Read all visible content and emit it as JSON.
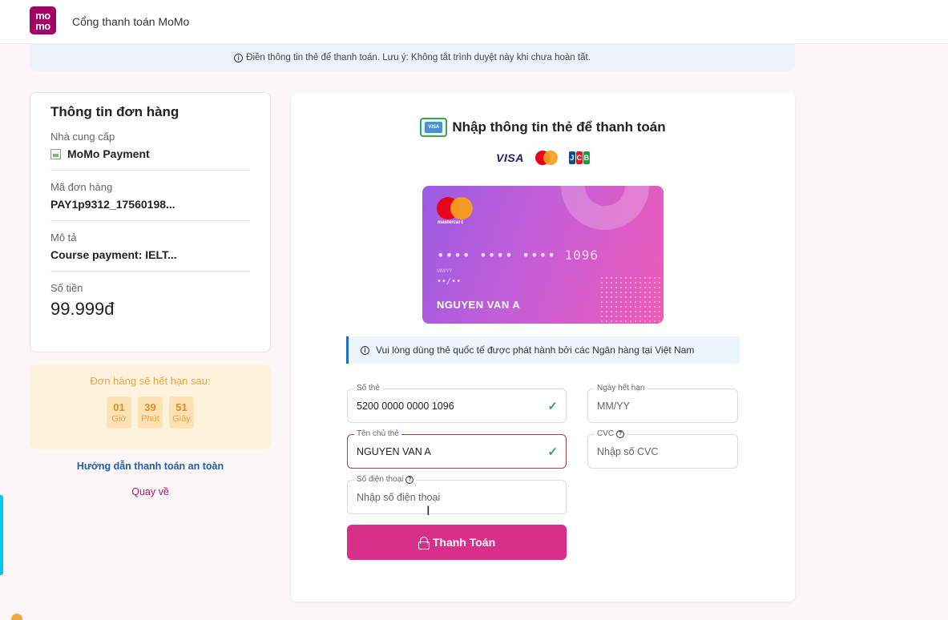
{
  "header": {
    "logo_top": "mo",
    "logo_bottom": "mo",
    "title": "Cổng thanh toán MoMo"
  },
  "notice": {
    "text": "Điền thông tin thẻ để thanh toán. Lưu ý: Không tắt trình duyệt này khi chưa hoàn tất."
  },
  "order": {
    "title": "Thông tin đơn hàng",
    "provider_label": "Nhà cung cấp",
    "provider_value": "MoMo Payment",
    "order_id_label": "Mã đơn hàng",
    "order_id_value": "PAY1p9312_17560198...",
    "desc_label": "Mô tả",
    "desc_value": "Course payment: IELT...",
    "amount_label": "Số tiền",
    "amount_value": "99.999đ"
  },
  "countdown": {
    "title": "Đơn hàng sẽ hết hạn sau:",
    "hours": "01",
    "hours_unit": "Giờ",
    "minutes": "39",
    "minutes_unit": "Phút",
    "seconds": "51",
    "seconds_unit": "Giây"
  },
  "links": {
    "guide": "Hướng dẫn thanh toán an toàn",
    "back": "Quay về"
  },
  "payment": {
    "title": "Nhập thông tin thẻ để thanh toán",
    "card_icon_text": "VISA",
    "brands": {
      "visa": "VISA",
      "jcb": [
        "J",
        "C",
        "B"
      ]
    },
    "card_preview": {
      "brand_label": "mastercard",
      "number": "•••• •••• •••• 1096",
      "expiry_label": "MM/YY",
      "expiry": "••/••",
      "holder": "NGUYEN VAN A"
    },
    "info": "Vui lòng dùng thẻ quốc tế được phát hành bởi các Ngân hàng tại Việt Nam",
    "fields": {
      "card_number_label": "Số thẻ",
      "card_number_value": "5200 0000 0000 1096",
      "expiry_label": "Ngày hết hạn",
      "expiry_placeholder": "MM/YY",
      "holder_label": "Tên chủ thẻ",
      "holder_value": "NGUYEN VAN A",
      "cvc_label": "CVC",
      "cvc_placeholder": "Nhập số CVC",
      "phone_label": "Số điện thoại",
      "phone_placeholder": "Nhập số điện thoại"
    },
    "submit": "Thanh Toán"
  },
  "colors": {
    "brand": "#a50064",
    "button": "#d8308a",
    "valid": "#3aa35a",
    "error_border": "#a54242",
    "info_accent": "#1b6ec2",
    "countdown_bg": "#fff3de"
  }
}
